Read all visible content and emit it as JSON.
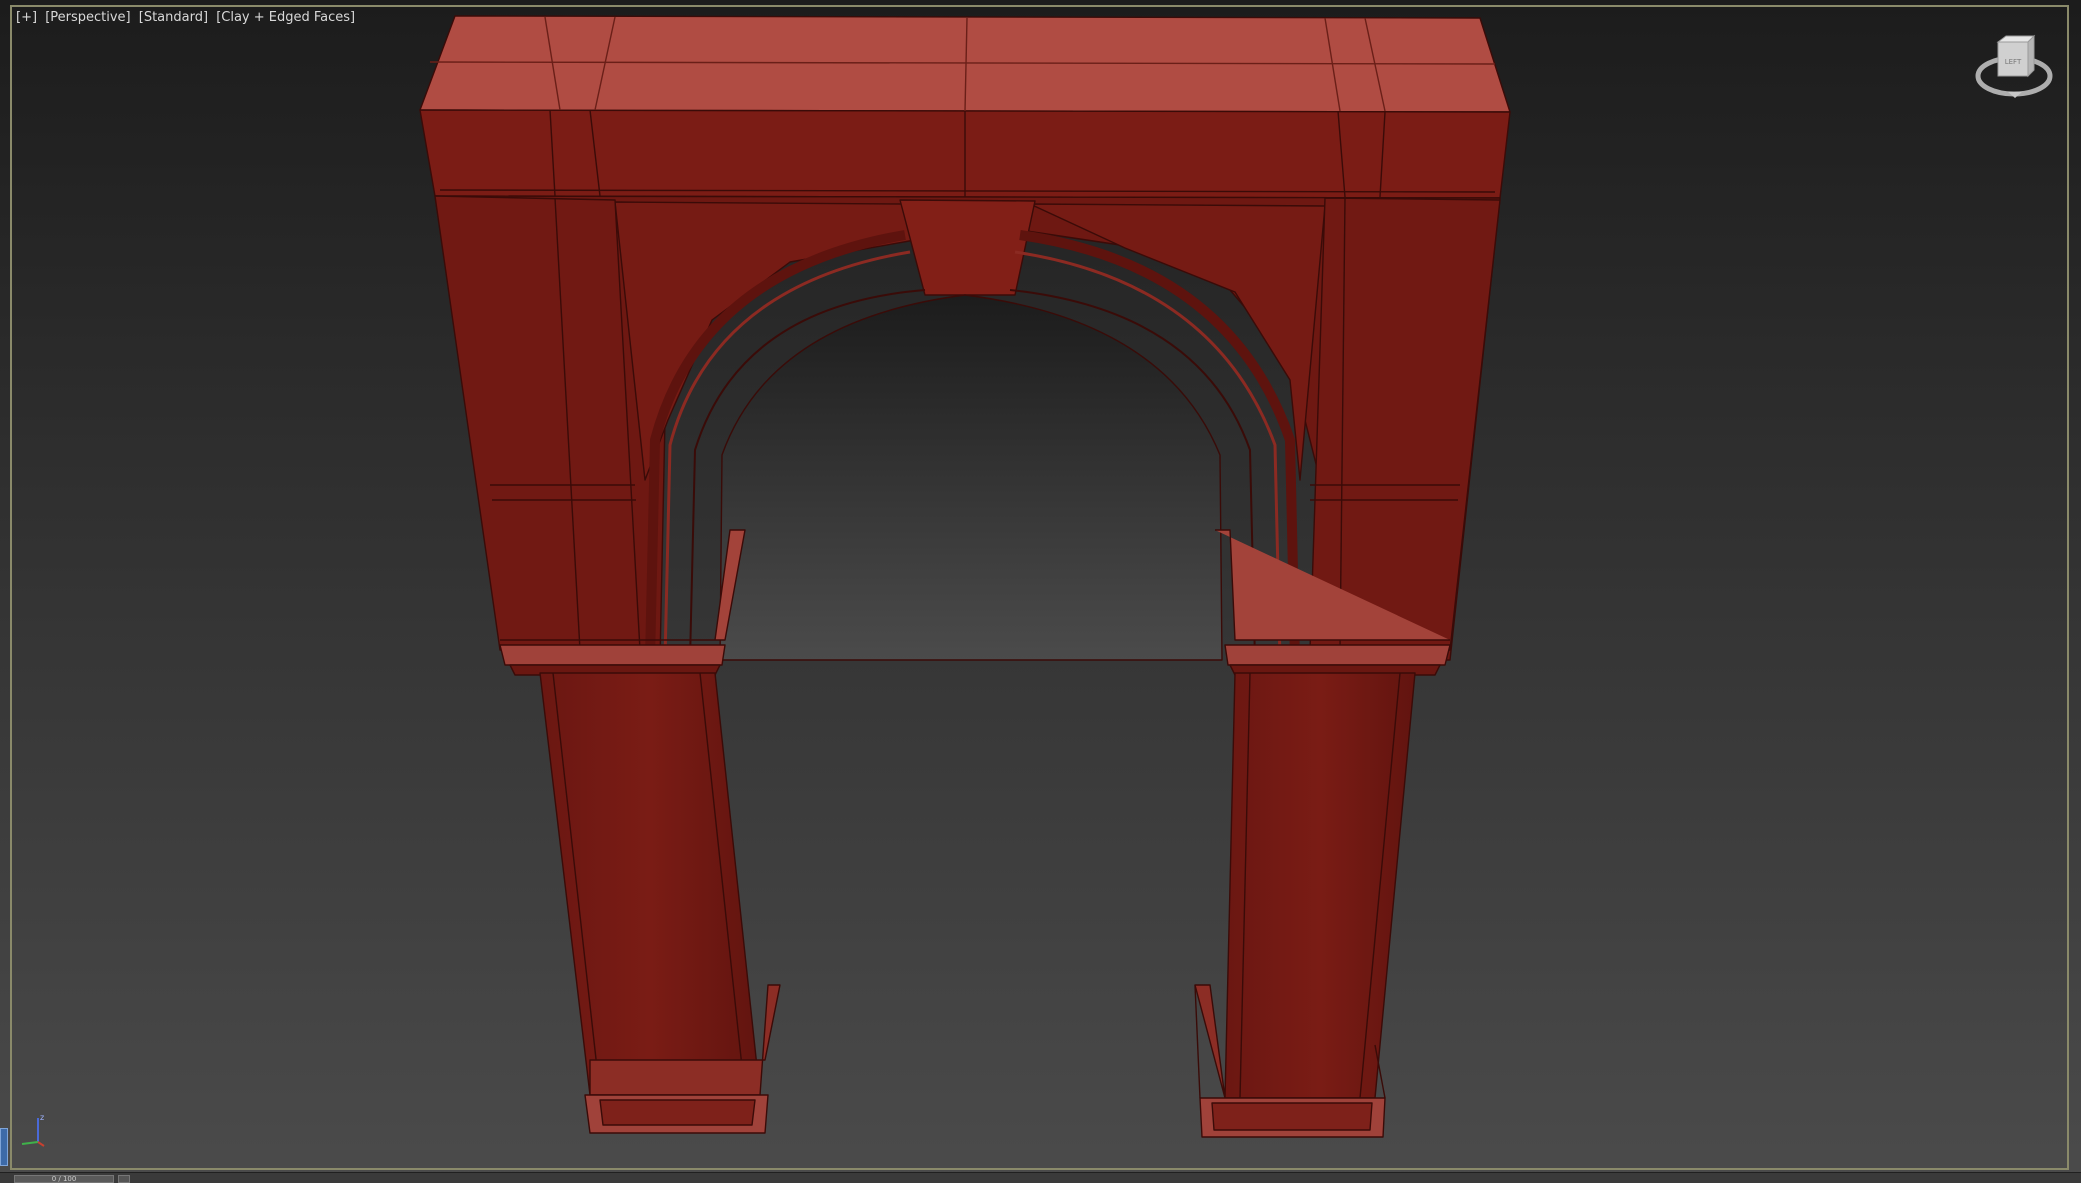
{
  "viewport": {
    "labels": [
      "[+]",
      "[Perspective]",
      "[Standard]",
      "[Clay + Edged Faces]"
    ],
    "view_name": "Perspective",
    "shading_mode": "Clay + Edged Faces"
  },
  "viewcube": {
    "face_label": "LEFT",
    "icon": "viewcube-icon"
  },
  "axis_tripod": {
    "icon": "axis-tripod-icon",
    "z_label": "z"
  },
  "time_slider": {
    "label": "0 / 100"
  },
  "colors": {
    "clay_front": "#741a14",
    "clay_top": "#b14d44",
    "viewport_top": "#1d1d1d",
    "viewport_bottom": "#4a4a4a",
    "edge_line": "#3a0b08"
  }
}
